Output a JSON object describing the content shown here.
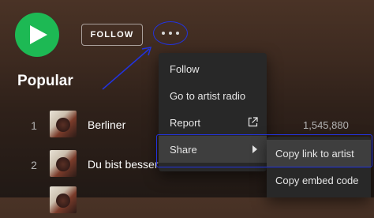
{
  "artist_actions": {
    "play_icon": "play-icon",
    "follow_label": "FOLLOW",
    "more_icon": "more-options-icon"
  },
  "section": {
    "title": "Popular"
  },
  "tracks": [
    {
      "number": "1",
      "title": "Berliner",
      "plays": "1,545,880"
    },
    {
      "number": "2",
      "title": "Du bist besser",
      "plays": ""
    },
    {
      "number": "",
      "title": "",
      "plays": ""
    }
  ],
  "context_menu": {
    "items": [
      {
        "label": "Follow"
      },
      {
        "label": "Go to artist radio"
      },
      {
        "label": "Report",
        "icon": "external-link-icon"
      },
      {
        "label": "Share",
        "icon": "chevron-right-icon",
        "active": true
      }
    ]
  },
  "share_submenu": {
    "items": [
      {
        "label": "Copy link to artist",
        "active": true
      },
      {
        "label": "Copy embed code"
      }
    ]
  },
  "colors": {
    "play_button": "#1db954",
    "menu_background": "#282828",
    "menu_hover": "#3e3e3e",
    "annotation": "#2233dd"
  }
}
